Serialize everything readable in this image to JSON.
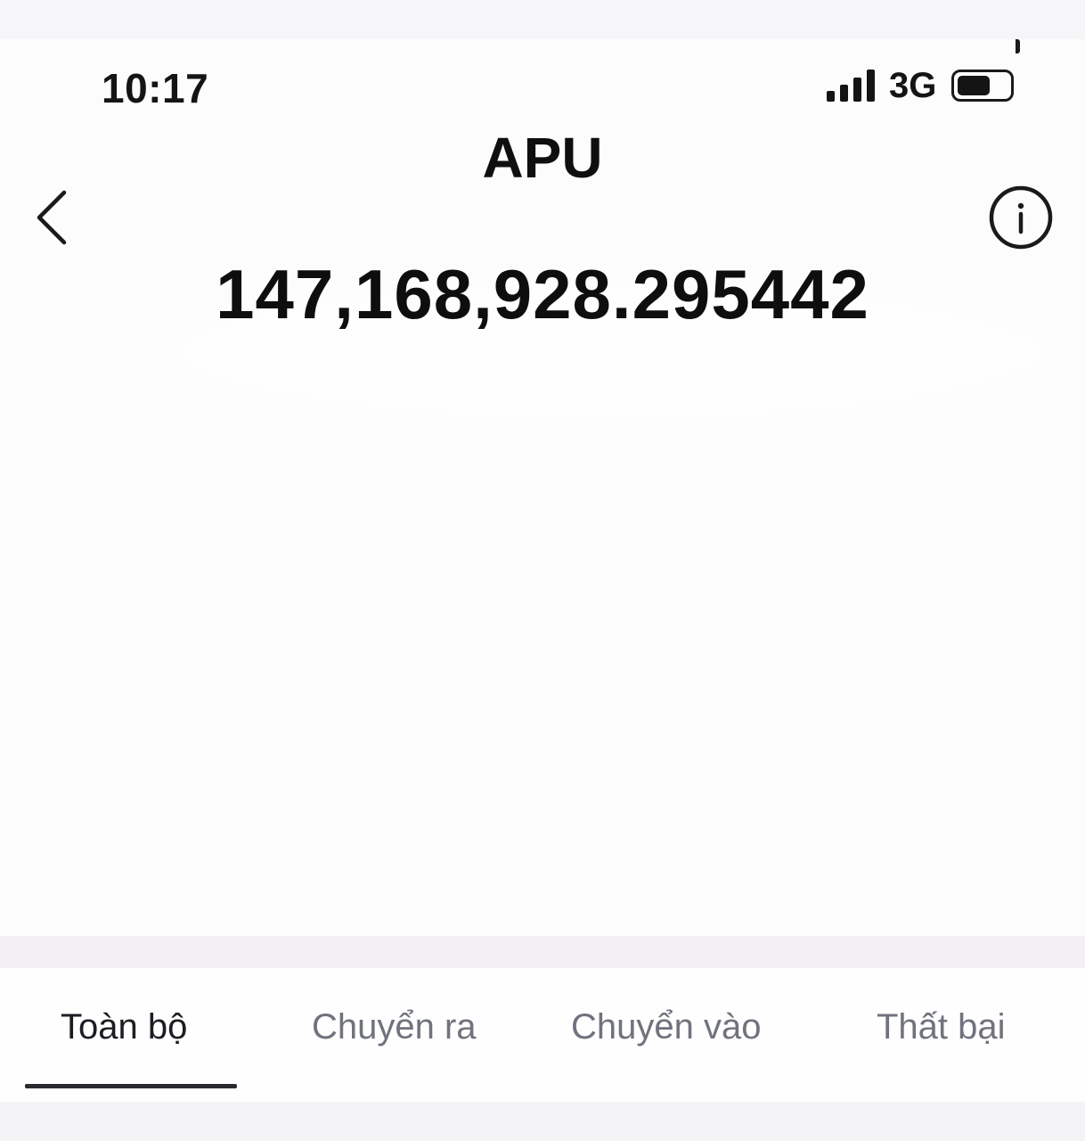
{
  "status_bar": {
    "time": "10:17",
    "network": "3G",
    "signal_icon": "signal-bars-icon",
    "battery_icon": "battery-icon",
    "battery_level": 0.65
  },
  "header": {
    "title": "APU",
    "back_icon": "chevron-left-icon",
    "info_icon": "info-circle-icon"
  },
  "balance": {
    "amount": "147,168,928.295442"
  },
  "tabs": [
    {
      "label": "Toàn bộ",
      "active": true
    },
    {
      "label": "Chuyển ra",
      "active": false
    },
    {
      "label": "Chuyển vào",
      "active": false
    },
    {
      "label": "Thất bại",
      "active": false
    }
  ],
  "colors": {
    "active_tab": "#1c1c22",
    "inactive_tab": "#70737d",
    "underline": "#2a2a2e",
    "background": "#fdfcfd"
  }
}
